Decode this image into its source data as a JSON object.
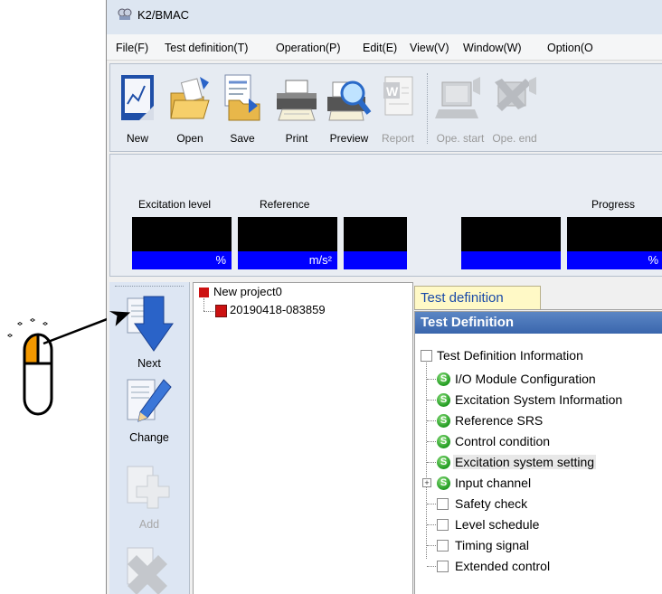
{
  "window": {
    "title": "K2/BMAC"
  },
  "menu": [
    {
      "label": "File(F)"
    },
    {
      "label": "Test definition(T)"
    },
    {
      "label": "Operation(P)"
    },
    {
      "label": "Edit(E)"
    },
    {
      "label": "View(V)"
    },
    {
      "label": "Window(W)"
    },
    {
      "label": "Option(O"
    }
  ],
  "toolbar": [
    {
      "label": "New",
      "icon": "new-icon",
      "enabled": true
    },
    {
      "label": "Open",
      "icon": "open-folder-icon",
      "enabled": true
    },
    {
      "label": "Save",
      "icon": "save-icon",
      "enabled": true
    },
    {
      "label": "Print",
      "icon": "printer-icon",
      "enabled": true
    },
    {
      "label": "Preview",
      "icon": "preview-icon",
      "enabled": true
    },
    {
      "label": "Report",
      "icon": "report-icon",
      "enabled": false
    },
    {
      "label": "Ope. start",
      "icon": "operation-start-icon",
      "enabled": false
    },
    {
      "label": "Ope. end",
      "icon": "operation-end-icon",
      "enabled": false
    }
  ],
  "monitor": {
    "labels": [
      {
        "text": "Excitation level"
      },
      {
        "text": "Reference"
      },
      {
        "text": "Progress"
      }
    ],
    "boxes": [
      {
        "unit": "%"
      },
      {
        "unit": "m/s²"
      },
      {
        "unit": ""
      },
      {
        "unit": ""
      },
      {
        "unit": "%"
      }
    ]
  },
  "sidebar": [
    {
      "label": "Next",
      "icon": "next-arrow-icon",
      "enabled": true
    },
    {
      "label": "Change",
      "icon": "change-pencil-icon",
      "enabled": true
    },
    {
      "label": "Add",
      "icon": "add-plus-icon",
      "enabled": false
    },
    {
      "label": "",
      "icon": "delete-x-icon",
      "enabled": false
    }
  ],
  "project_tree": {
    "project": "New project0",
    "test": "20190418-083859"
  },
  "tab": {
    "label": "Test definition"
  },
  "panel": {
    "title": "Test Definition",
    "items": [
      {
        "label": "Test Definition Information",
        "state": "unchecked"
      },
      {
        "label": "I/O Module Configuration",
        "state": "set"
      },
      {
        "label": "Excitation System Information",
        "state": "set"
      },
      {
        "label": "Reference SRS",
        "state": "set"
      },
      {
        "label": "Control condition",
        "state": "set"
      },
      {
        "label": "Excitation system setting",
        "state": "set",
        "selected": true
      },
      {
        "label": "Input channel",
        "state": "set",
        "expandable": true
      },
      {
        "label": "Safety check",
        "state": "unchecked"
      },
      {
        "label": "Level schedule",
        "state": "unchecked"
      },
      {
        "label": "Timing signal",
        "state": "unchecked"
      },
      {
        "label": "Extended control",
        "state": "unchecked"
      }
    ]
  },
  "colors": {
    "monitor_unit_bg": "#0000ff",
    "panel_header": "#3a66ad",
    "tab_bg": "#fff9c6",
    "project_marker": "#cc1111",
    "mouse_button_highlight": "#f39800"
  }
}
